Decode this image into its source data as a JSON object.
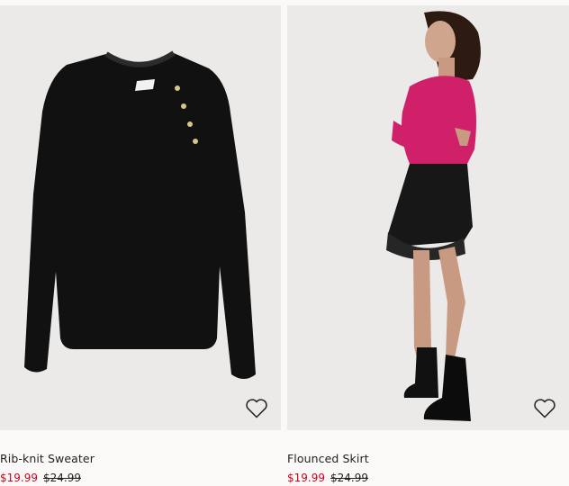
{
  "products": [
    {
      "name": "Rib-knit Sweater",
      "price": "$19.99",
      "original_price": "$24.99",
      "image": "black-ribbed-sweater",
      "favorite_icon": "heart-outline-icon"
    },
    {
      "name": "Flounced Skirt",
      "price": "$19.99",
      "original_price": "$24.99",
      "image": "model-in-black-flounced-skirt",
      "favorite_icon": "heart-outline-icon"
    }
  ],
  "colors": {
    "sale_price": "#d0021b",
    "image_background": "#eceae8",
    "page_background": "#faf9f8"
  }
}
